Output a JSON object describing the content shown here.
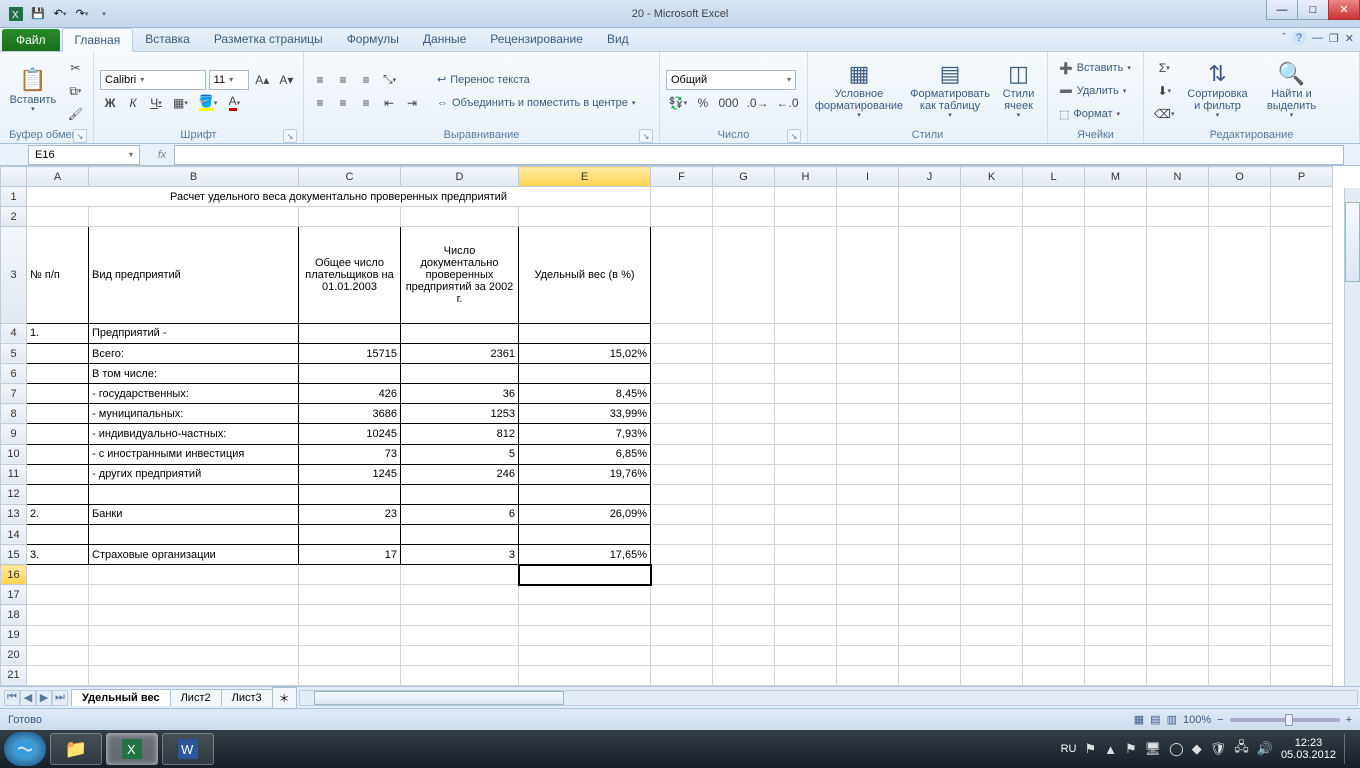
{
  "app": {
    "title": "20  -  Microsoft Excel"
  },
  "tabs": {
    "file": "Файл",
    "items": [
      "Главная",
      "Вставка",
      "Разметка страницы",
      "Формулы",
      "Данные",
      "Рецензирование",
      "Вид"
    ],
    "active": 0
  },
  "ribbon": {
    "clipboard": {
      "paste": "Вставить",
      "label": "Буфер обмена"
    },
    "font": {
      "family": "Calibri",
      "size": "11",
      "bold": "Ж",
      "italic": "К",
      "underline": "Ч",
      "label": "Шрифт"
    },
    "align": {
      "wrap": "Перенос текста",
      "merge": "Объединить и поместить в центре",
      "label": "Выравнивание"
    },
    "number": {
      "format": "Общий",
      "label": "Число"
    },
    "styles": {
      "cond": "Условное форматирование",
      "table": "Форматировать как таблицу",
      "cell": "Стили ячеек",
      "label": "Стили"
    },
    "cells": {
      "insert": "Вставить",
      "delete": "Удалить",
      "format": "Формат",
      "label": "Ячейки"
    },
    "editing": {
      "sort": "Сортировка и фильтр",
      "find": "Найти и выделить",
      "label": "Редактирование"
    }
  },
  "namebox": "E16",
  "columns": [
    "A",
    "B",
    "C",
    "D",
    "E",
    "F",
    "G",
    "H",
    "I",
    "J",
    "K",
    "L",
    "M",
    "N",
    "O",
    "P"
  ],
  "rowcount": 21,
  "activeCol": 4,
  "activeRow": 16,
  "title_row": "Расчет удельного веса документально проверенных предприятий",
  "headers": {
    "A": "№ п/п",
    "B": "Вид предприятий",
    "C": "Общее число плательщиков на 01.01.2003",
    "D": "Число документально проверенных предприятий за 2002 г.",
    "E": "Удельный вес (в %)"
  },
  "rows": [
    {
      "n": "1.",
      "b": "Предприятий -",
      "c": "",
      "d": "",
      "e": ""
    },
    {
      "n": "",
      "b": "Всего:",
      "c": "15715",
      "d": "2361",
      "e": "15,02%"
    },
    {
      "n": "",
      "b": "В том числе:",
      "c": "",
      "d": "",
      "e": ""
    },
    {
      "n": "",
      "b": " - государственных:",
      "c": "426",
      "d": "36",
      "e": "8,45%"
    },
    {
      "n": "",
      "b": " - муниципальных:",
      "c": "3686",
      "d": "1253",
      "e": "33,99%"
    },
    {
      "n": "",
      "b": " - индивидуально-частных:",
      "c": "10245",
      "d": "812",
      "e": "7,93%"
    },
    {
      "n": "",
      "b": " - с иностранными инвестиция",
      "c": "73",
      "d": "5",
      "e": "6,85%"
    },
    {
      "n": "",
      "b": " - других предприятий",
      "c": "1245",
      "d": "246",
      "e": "19,76%"
    },
    {
      "n": "",
      "b": "",
      "c": "",
      "d": "",
      "e": ""
    },
    {
      "n": "2.",
      "b": "Банки",
      "c": "23",
      "d": "6",
      "e": "26,09%"
    },
    {
      "n": "",
      "b": "",
      "c": "",
      "d": "",
      "e": ""
    },
    {
      "n": "3.",
      "b": "Страховые организации",
      "c": "17",
      "d": "3",
      "e": "17,65%"
    }
  ],
  "sheets": {
    "tabs": [
      "Удельный вес",
      "Лист2",
      "Лист3"
    ],
    "active": 0
  },
  "status": {
    "ready": "Готово",
    "zoom": "100%"
  },
  "taskbar": {
    "lang": "RU",
    "time": "12:23",
    "date": "05.03.2012"
  }
}
